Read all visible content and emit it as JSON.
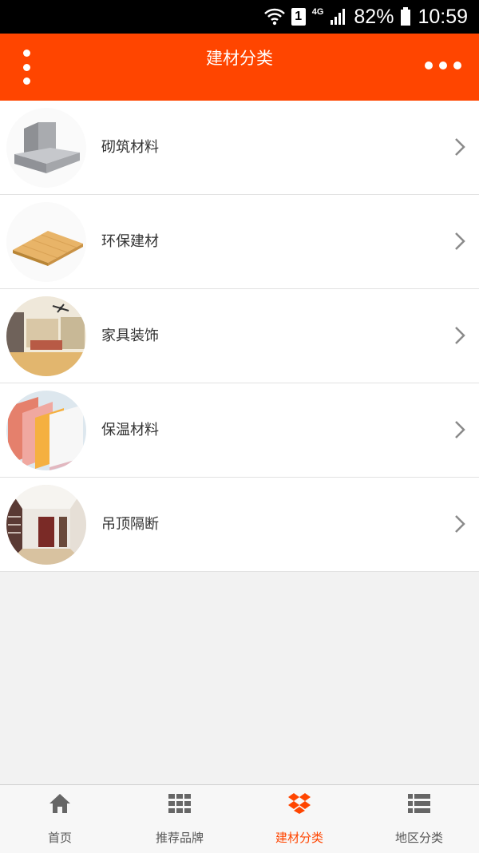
{
  "status_bar": {
    "battery": "82%",
    "time": "10:59",
    "sim_slot": "1",
    "network": "4G"
  },
  "header": {
    "title": "建材分类"
  },
  "categories": [
    {
      "label": "砌筑材料",
      "image": "concrete-blocks-image"
    },
    {
      "label": "环保建材",
      "image": "wood-panel-image"
    },
    {
      "label": "家具装饰",
      "image": "living-room-image"
    },
    {
      "label": "保温材料",
      "image": "insulation-boards-image"
    },
    {
      "label": "吊顶隔断",
      "image": "ceiling-hallway-image"
    }
  ],
  "tabbar": {
    "active_color": "#ff4500",
    "tabs": [
      {
        "label": "首页",
        "icon": "home-icon"
      },
      {
        "label": "推荐品牌",
        "icon": "grid-icon"
      },
      {
        "label": "建材分类",
        "icon": "dropbox-icon"
      },
      {
        "label": "地区分类",
        "icon": "list-icon"
      }
    ]
  }
}
